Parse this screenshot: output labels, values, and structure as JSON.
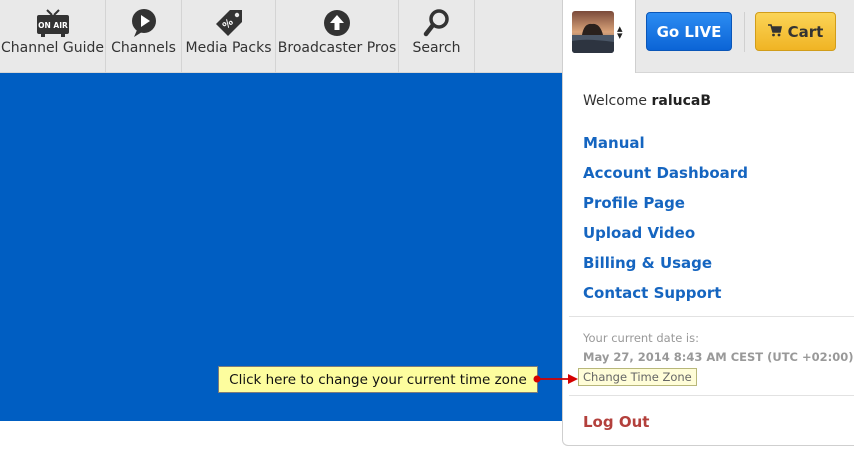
{
  "nav": {
    "items": [
      {
        "label": "Channel Guide",
        "icon": "tv-on-air-icon",
        "badge": "ON AIR"
      },
      {
        "label": "Channels",
        "icon": "play-icon"
      },
      {
        "label": "Media Packs",
        "icon": "price-tag-icon"
      },
      {
        "label": "Broadcaster Pros",
        "icon": "upload-arrow-icon"
      },
      {
        "label": "Search",
        "icon": "search-icon"
      }
    ]
  },
  "header": {
    "go_live_label": "Go LIVE",
    "cart_label": "Cart"
  },
  "dropdown": {
    "welcome_prefix": "Welcome",
    "username": "ralucaB",
    "links": [
      "Manual",
      "Account Dashboard",
      "Profile Page",
      "Upload Video",
      "Billing & Usage",
      "Contact Support"
    ],
    "date_caption": "Your current date is:",
    "date_value": "May 27, 2014 8:43 AM CEST (UTC +02:00)",
    "change_tz_label": "Change Time Zone",
    "logout_label": "Log Out"
  },
  "callout": {
    "text": "Click here to change your current time zone"
  },
  "colors": {
    "hero": "#005ec2",
    "link": "#1565c0",
    "logout": "#b3403c",
    "go_live": "#0b64d6",
    "cart": "#f0b424",
    "callout_bg": "#fdfd9e"
  }
}
